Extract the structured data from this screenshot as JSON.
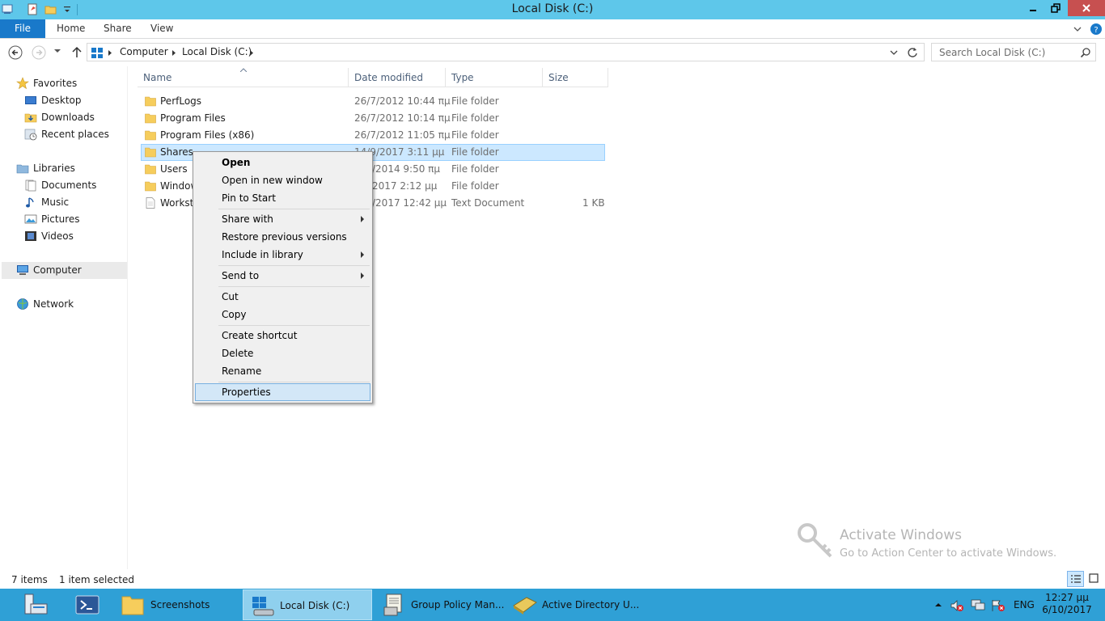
{
  "window": {
    "title": "Local Disk (C:)"
  },
  "ribbon": {
    "tabs": [
      "File",
      "Home",
      "Share",
      "View"
    ]
  },
  "address": {
    "crumbs": [
      "Computer",
      "Local Disk (C:)"
    ],
    "search_placeholder": "Search Local Disk (C:)"
  },
  "navpane": {
    "favorites": {
      "label": "Favorites",
      "items": [
        "Desktop",
        "Downloads",
        "Recent places"
      ]
    },
    "libraries": {
      "label": "Libraries",
      "items": [
        "Documents",
        "Music",
        "Pictures",
        "Videos"
      ]
    },
    "computer": "Computer",
    "network": "Network"
  },
  "columns": [
    "Name",
    "Date modified",
    "Type",
    "Size"
  ],
  "files": [
    {
      "name": "PerfLogs",
      "date": "26/7/2012 10:44 πμ",
      "type": "File folder",
      "size": "",
      "icon": "folder-icon"
    },
    {
      "name": "Program Files",
      "date": "26/7/2012 10:14 πμ",
      "type": "File folder",
      "size": "",
      "icon": "folder-icon"
    },
    {
      "name": "Program Files (x86)",
      "date": "26/7/2012 11:05 πμ",
      "type": "File folder",
      "size": "",
      "icon": "folder-icon"
    },
    {
      "name": "Shares",
      "date": "14/9/2017 3:11 μμ",
      "type": "File folder",
      "size": "",
      "icon": "folder-icon",
      "selected": true
    },
    {
      "name": "Users",
      "date": "/2014 9:50 πμ",
      "type": "File folder",
      "size": "",
      "icon": "folder-icon"
    },
    {
      "name": "Window",
      "date": "2017 2:12 μμ",
      "type": "File folder",
      "size": "",
      "icon": "folder-icon"
    },
    {
      "name": "Worksta",
      "date": "/2017 12:42 μμ",
      "type": "Text Document",
      "size": "1 KB",
      "icon": "text-file-icon"
    }
  ],
  "context_menu": {
    "items": [
      {
        "label": "Open",
        "bold": true
      },
      {
        "label": "Open in new window"
      },
      {
        "label": "Pin to Start"
      },
      {
        "label": "Share with",
        "submenu": true
      },
      {
        "label": "Restore previous versions"
      },
      {
        "label": "Include in library",
        "submenu": true
      },
      {
        "label": "Send to",
        "submenu": true
      },
      {
        "label": "Cut"
      },
      {
        "label": "Copy"
      },
      {
        "label": "Create shortcut"
      },
      {
        "label": "Delete"
      },
      {
        "label": "Rename"
      },
      {
        "label": "Properties",
        "highlighted": true
      }
    ]
  },
  "status": {
    "count": "7 items",
    "selection": "1 item selected"
  },
  "watermark": {
    "line1": "Activate Windows",
    "line2": "Go to Action Center to activate Windows."
  },
  "taskbar": {
    "items": [
      {
        "label": "Screenshots"
      },
      {
        "label": "Local Disk (C:)",
        "active": true
      },
      {
        "label": "Group Policy Man..."
      },
      {
        "label": "Active Directory U..."
      }
    ],
    "lang": "ENG",
    "time": "12:27 μμ",
    "date": "6/10/2017"
  },
  "colors": {
    "titlebar": "#5ec7ea",
    "file_tab": "#1979ca",
    "selection": "#cce8ff",
    "taskbar": "#2fa0d6",
    "close": "#c75050"
  }
}
